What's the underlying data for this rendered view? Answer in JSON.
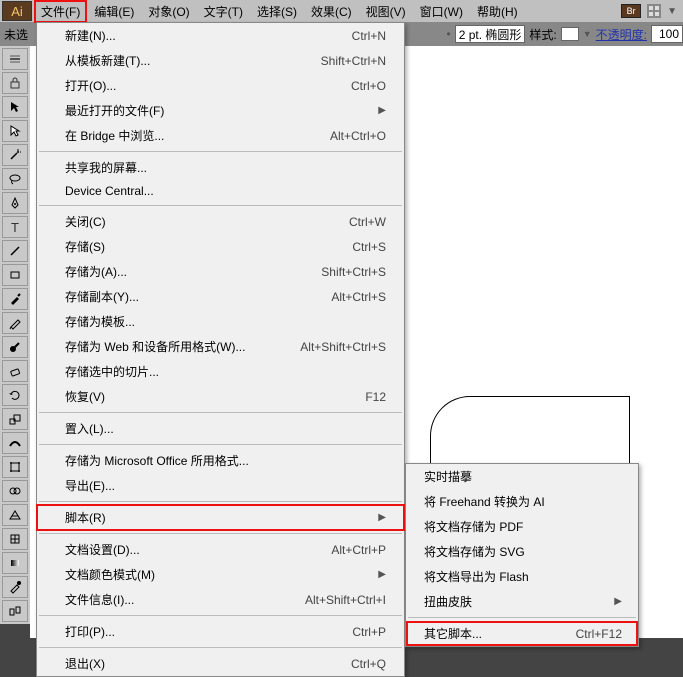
{
  "menubar": {
    "items": [
      "文件(F)",
      "编辑(E)",
      "对象(O)",
      "文字(T)",
      "选择(S)",
      "效果(C)",
      "视图(V)",
      "窗口(W)",
      "帮助(H)"
    ]
  },
  "options": {
    "left_label": "未选",
    "stroke_label": "2 pt. 椭圆形",
    "style_label": "样式:",
    "opacity_label": "不透明度:",
    "opacity_value": "100"
  },
  "file_menu": [
    {
      "label": "新建(N)...",
      "shortcut": "Ctrl+N"
    },
    {
      "label": "从模板新建(T)...",
      "shortcut": "Shift+Ctrl+N"
    },
    {
      "label": "打开(O)...",
      "shortcut": "Ctrl+O"
    },
    {
      "label": "最近打开的文件(F)",
      "arrow": true
    },
    {
      "label": "在 Bridge 中浏览...",
      "shortcut": "Alt+Ctrl+O"
    },
    {
      "sep": true
    },
    {
      "label": "共享我的屏幕..."
    },
    {
      "label": "Device Central..."
    },
    {
      "sep": true
    },
    {
      "label": "关闭(C)",
      "shortcut": "Ctrl+W"
    },
    {
      "label": "存储(S)",
      "shortcut": "Ctrl+S"
    },
    {
      "label": "存储为(A)...",
      "shortcut": "Shift+Ctrl+S"
    },
    {
      "label": "存储副本(Y)...",
      "shortcut": "Alt+Ctrl+S"
    },
    {
      "label": "存储为模板..."
    },
    {
      "label": "存储为 Web 和设备所用格式(W)...",
      "shortcut": "Alt+Shift+Ctrl+S"
    },
    {
      "label": "存储选中的切片..."
    },
    {
      "label": "恢复(V)",
      "shortcut": "F12"
    },
    {
      "sep": true
    },
    {
      "label": "置入(L)..."
    },
    {
      "sep": true
    },
    {
      "label": "存储为 Microsoft Office 所用格式..."
    },
    {
      "label": "导出(E)..."
    },
    {
      "sep": true
    },
    {
      "label": "脚本(R)",
      "arrow": true,
      "highlight": true
    },
    {
      "sep": true
    },
    {
      "label": "文档设置(D)...",
      "shortcut": "Alt+Ctrl+P"
    },
    {
      "label": "文档颜色模式(M)",
      "arrow": true
    },
    {
      "label": "文件信息(I)...",
      "shortcut": "Alt+Shift+Ctrl+I"
    },
    {
      "sep": true
    },
    {
      "label": "打印(P)...",
      "shortcut": "Ctrl+P"
    },
    {
      "sep": true
    },
    {
      "label": "退出(X)",
      "shortcut": "Ctrl+Q"
    }
  ],
  "script_submenu": [
    {
      "label": "实时描摹"
    },
    {
      "label": "将 Freehand 转换为 AI"
    },
    {
      "label": "将文档存储为 PDF"
    },
    {
      "label": "将文档存储为 SVG"
    },
    {
      "label": "将文档导出为 Flash"
    },
    {
      "label": "扭曲皮肤",
      "arrow": true
    },
    {
      "sep": true
    },
    {
      "label": "其它脚本...",
      "shortcut": "Ctrl+F12",
      "highlight": true
    }
  ],
  "tools": [
    {
      "name": "grip-icon"
    },
    {
      "name": "lock-icon"
    },
    {
      "name": "selection-tool-icon"
    },
    {
      "name": "direct-selection-tool-icon"
    },
    {
      "name": "magic-wand-tool-icon"
    },
    {
      "name": "lasso-tool-icon"
    },
    {
      "name": "pen-tool-icon"
    },
    {
      "name": "type-tool-icon"
    },
    {
      "name": "line-tool-icon"
    },
    {
      "name": "rectangle-tool-icon"
    },
    {
      "name": "paintbrush-tool-icon"
    },
    {
      "name": "pencil-tool-icon"
    },
    {
      "name": "blob-brush-tool-icon"
    },
    {
      "name": "eraser-tool-icon"
    },
    {
      "name": "rotate-tool-icon"
    },
    {
      "name": "scale-tool-icon"
    },
    {
      "name": "width-tool-icon"
    },
    {
      "name": "free-transform-tool-icon"
    },
    {
      "name": "shape-builder-tool-icon"
    },
    {
      "name": "perspective-grid-tool-icon"
    },
    {
      "name": "mesh-tool-icon"
    },
    {
      "name": "gradient-tool-icon"
    },
    {
      "name": "eyedropper-tool-icon"
    },
    {
      "name": "blend-tool-icon"
    }
  ]
}
